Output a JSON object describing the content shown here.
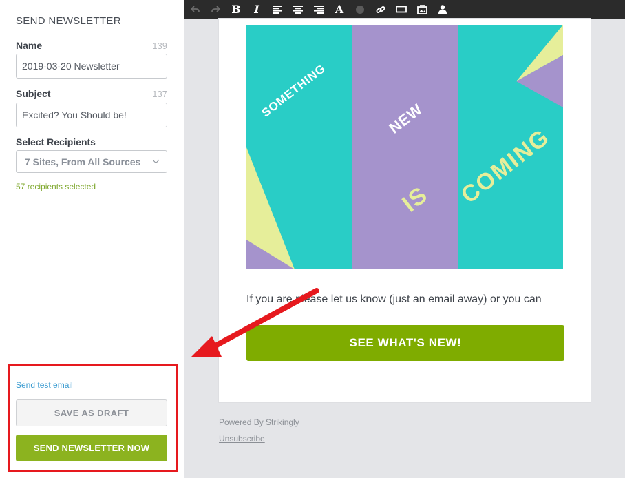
{
  "panel": {
    "title": "SEND NEWSLETTER",
    "name": {
      "label": "Name",
      "count": "139",
      "value": "2019-03-20 Newsletter"
    },
    "subject": {
      "label": "Subject",
      "count": "137",
      "value": "Excited? You Should be!"
    },
    "recipients": {
      "label": "Select Recipients",
      "selected": "7 Sites, From All Sources",
      "count_text": "57 recipients selected"
    },
    "send_test_label": "Send test email",
    "save_draft_label": "SAVE AS DRAFT",
    "send_now_label": "SEND NEWSLETTER NOW"
  },
  "toolbar": {
    "icons": [
      "undo-icon",
      "redo-icon",
      "bold-icon",
      "italic-icon",
      "align-left-icon",
      "align-center-icon",
      "align-right-icon",
      "font-icon",
      "color-icon",
      "link-icon",
      "button-icon",
      "image-icon",
      "user-icon"
    ],
    "bold_glyph": "B",
    "italic_glyph": "I",
    "font_glyph": "A"
  },
  "email": {
    "hero": {
      "words": [
        "SOMETHING",
        "NEW",
        "IS",
        "COMING"
      ],
      "colors": {
        "teal": "#29cdc6",
        "purple": "#a593cc",
        "yellow": "#e6ee9a"
      }
    },
    "body_text": "If  you are  please let us know (just an email away) or you can",
    "cta_label": "SEE WHAT'S NEW!",
    "cta_color": "#7fac00"
  },
  "footer": {
    "powered_prefix": "Powered By ",
    "powered_link": "Strikingly",
    "unsubscribe": "Unsubscribe"
  },
  "annotation": {
    "color": "#e6191e"
  }
}
